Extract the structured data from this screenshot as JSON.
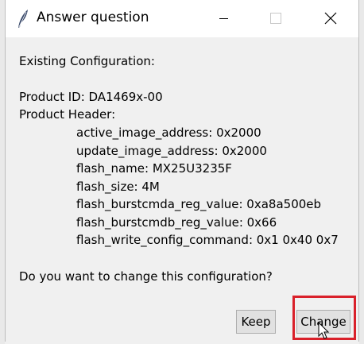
{
  "window": {
    "title": "Answer question",
    "icon": "feather-icon",
    "controls": [
      "minimize-icon",
      "maximize-icon",
      "close-icon"
    ]
  },
  "message": {
    "intro": "Existing Configuration:",
    "product_id": "Product ID: DA1469x-00",
    "product_header_label": "Product Header:",
    "header_fields": [
      "active_image_address: 0x2000",
      "update_image_address: 0x2000",
      "flash_name: MX25U3235F",
      "flash_size: 4M",
      "flash_burstcmda_reg_value: 0xa8a500eb",
      "flash_burstcmdb_reg_value: 0x66",
      "flash_write_config_command: 0x1 0x40 0x7"
    ],
    "question": "Do you want to change this configuration?"
  },
  "buttons": {
    "keep": "Keep",
    "change": "Change"
  },
  "colors": {
    "highlight": "#d9202a",
    "dialog_bg": "#f0f0f0",
    "button_bg": "#e1e1e1"
  }
}
